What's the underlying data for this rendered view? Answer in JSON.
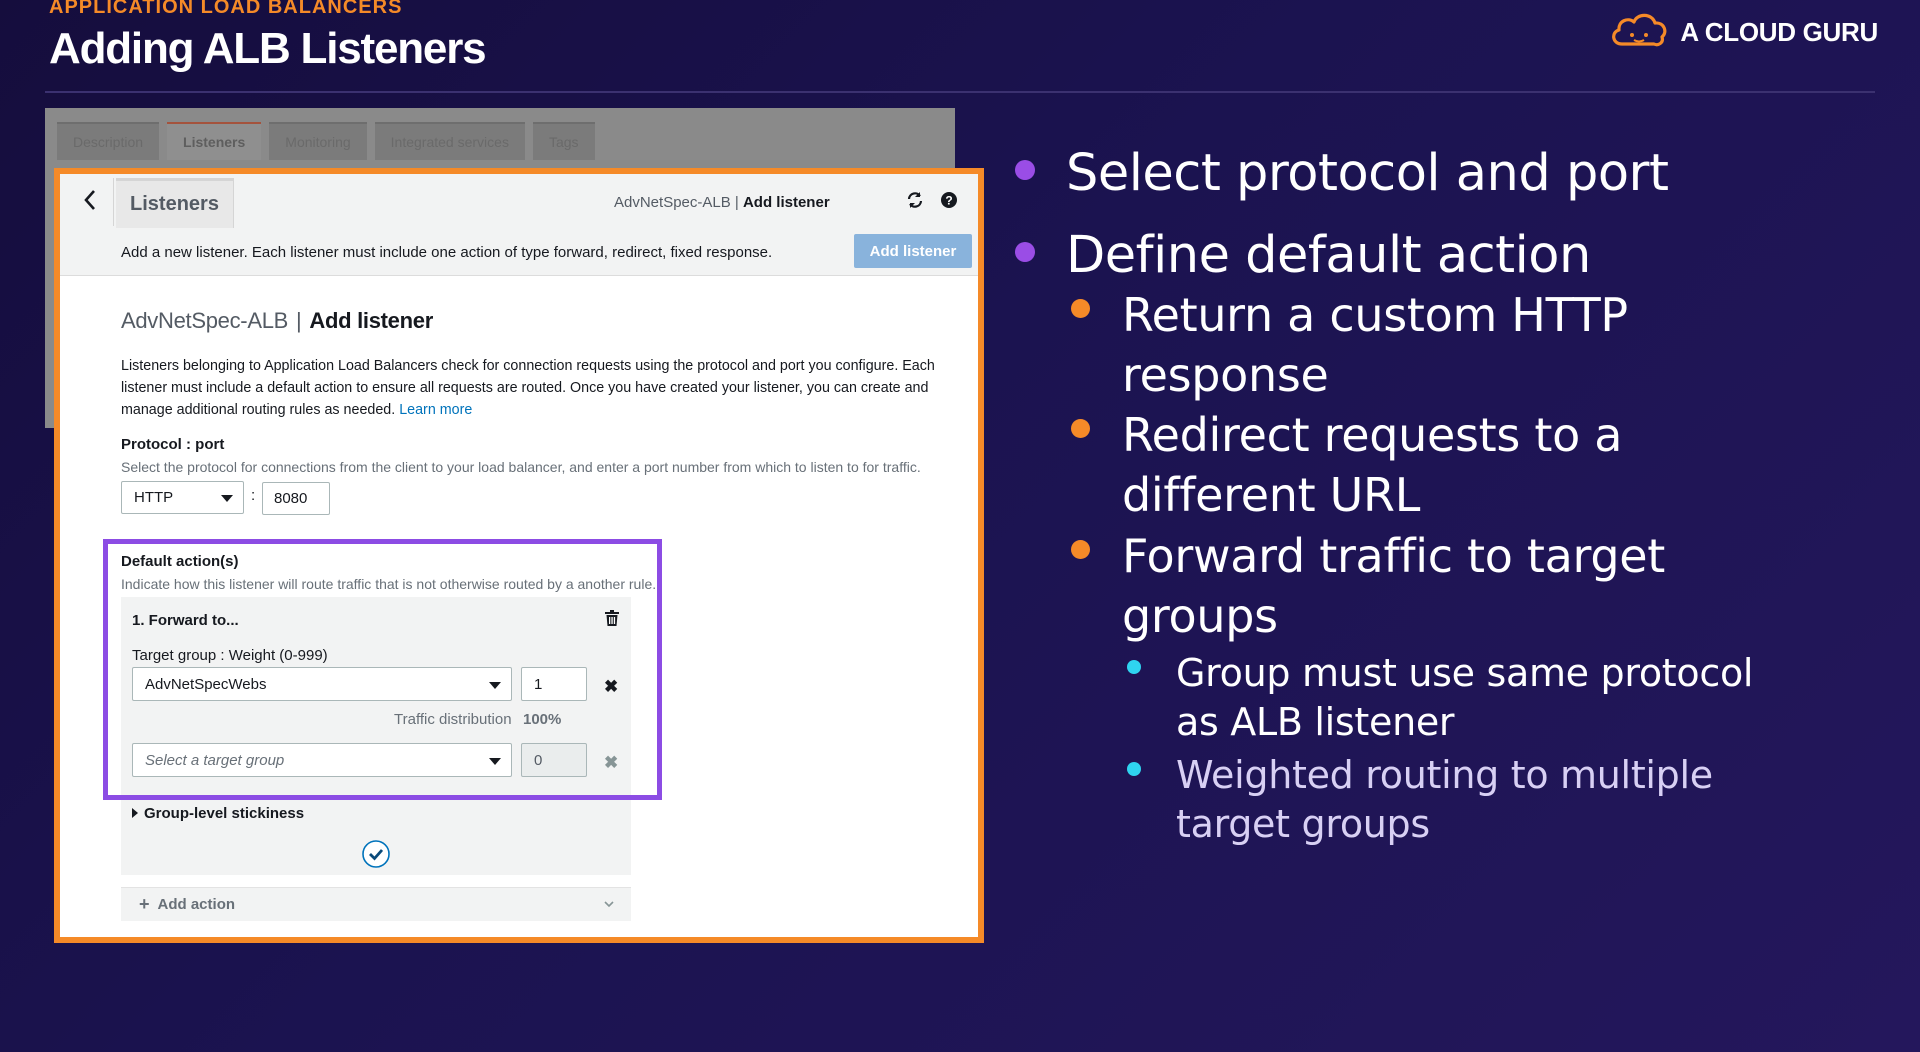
{
  "header": {
    "eyebrow": "APPLICATION LOAD BALANCERS",
    "title": "Adding ALB Listeners",
    "brand": "A CLOUD GURU"
  },
  "console": {
    "background_tabs": [
      "Description",
      "Listeners",
      "Monitoring",
      "Integrated services",
      "Tags"
    ],
    "active_tab": "Listeners",
    "breadcrumb_prefix": "AdvNetSpec-ALB |",
    "breadcrumb_current": "Add listener",
    "info_line": "Add a new listener. Each listener must include one action of type forward, redirect, fixed response.",
    "add_listener_button": "Add listener",
    "form_title_prefix": "AdvNetSpec-ALB",
    "form_title_separator": "|",
    "form_title": "Add listener",
    "description": "Listeners belonging to Application Load Balancers check for connection requests using the protocol and port you configure. Each listener must include a default action to ensure all requests are routed. Once you have created your listener, you can create and manage additional routing rules as needed.",
    "learn_more": "Learn more",
    "protocol_port_label": "Protocol : port",
    "protocol_port_help": "Select the protocol for connections from the client to your load balancer, and enter a port number from which to listen to for traffic.",
    "protocol_value": "HTTP",
    "port_separator": ":",
    "port_value": "8080",
    "default_actions_label": "Default action(s)",
    "default_actions_help": "Indicate how this listener will route traffic that is not otherwise routed by a another rule.",
    "action_heading": "1. Forward to...",
    "target_group_label": "Target group : Weight (0-999)",
    "target_group_value": "AdvNetSpecWebs",
    "weight_value": "1",
    "traffic_distribution_label": "Traffic distribution",
    "traffic_distribution_value": "100%",
    "target_group_placeholder": "Select a target group",
    "weight_value_2": "0",
    "stickiness_label": "Group-level stickiness",
    "add_action_label": "Add action"
  },
  "bullets": {
    "l1_a": "Select protocol and port",
    "l1_b": "Define default action",
    "l2_a": [
      "Return a custom HTTP",
      "response"
    ],
    "l2_b": [
      "Redirect requests to a",
      "different URL"
    ],
    "l2_c": [
      "Forward traffic to target",
      "groups"
    ],
    "l3_a": [
      "Group must use same protocol",
      "as ALB listener"
    ],
    "l3_b": [
      "Weighted routing to multiple",
      "target groups"
    ]
  },
  "colors": {
    "accent_orange": "#f58a28",
    "accent_purple": "#8c4ce4",
    "accent_cyan": "#2fd4f0",
    "aws_button_blue": "#89b3dc"
  }
}
